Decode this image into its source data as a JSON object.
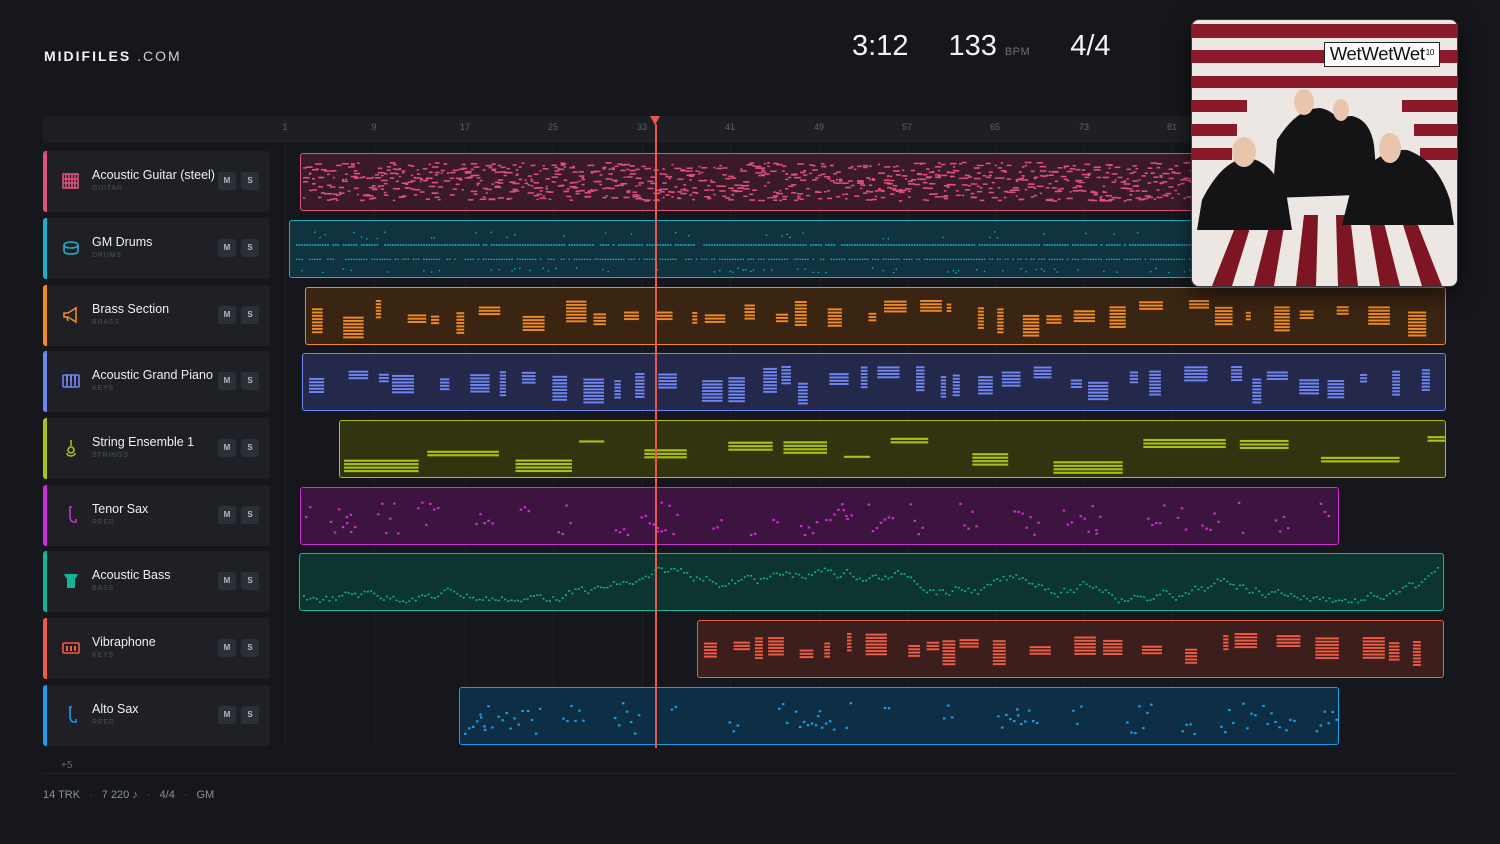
{
  "brand": {
    "name_bold": "MIDIFILES",
    "name_suffix": ".COM"
  },
  "transport": {
    "time": "3:12",
    "bpm": "133",
    "bpm_unit": "BPM",
    "time_signature": "4/4"
  },
  "ruler_ticks": [
    "1",
    "9",
    "17",
    "25",
    "33",
    "41",
    "49",
    "57",
    "65",
    "73",
    "81"
  ],
  "tracks": [
    {
      "name": "Acoustic Guitar (steel)",
      "category": "GUITAR",
      "icon": "guitar-icon",
      "color": "#e0507e",
      "mute": "M",
      "solo": "S"
    },
    {
      "name": "GM Drums",
      "category": "DRUMS",
      "icon": "drum-icon",
      "color": "#1eaec8",
      "mute": "M",
      "solo": "S"
    },
    {
      "name": "Brass Section",
      "category": "BRASS",
      "icon": "horn-icon",
      "color": "#f08a24",
      "mute": "M",
      "solo": "S"
    },
    {
      "name": "Acoustic Grand Piano",
      "category": "KEYS",
      "icon": "piano-icon",
      "color": "#6f86f2",
      "mute": "M",
      "solo": "S"
    },
    {
      "name": "String Ensemble 1",
      "category": "STRINGS",
      "icon": "violin-icon",
      "color": "#a8c219",
      "mute": "M",
      "solo": "S"
    },
    {
      "name": "Tenor Sax",
      "category": "REED",
      "icon": "sax-icon",
      "color": "#d12ad8",
      "mute": "M",
      "solo": "S"
    },
    {
      "name": "Acoustic Bass",
      "category": "BASS",
      "icon": "bass-icon",
      "color": "#13b59a",
      "mute": "M",
      "solo": "S"
    },
    {
      "name": "Vibraphone",
      "category": "KEYS",
      "icon": "vibraphone-icon",
      "color": "#f05b45",
      "mute": "M",
      "solo": "S"
    },
    {
      "name": "Alto Sax",
      "category": "REED",
      "icon": "sax-icon",
      "color": "#1b9de8",
      "mute": "M",
      "solo": "S"
    }
  ],
  "more_tracks": "+5",
  "footer": {
    "tracks": "14 TRK",
    "notes": "7 220 ♪",
    "time_signature": "4/4",
    "standard": "GM",
    "separator": "·"
  },
  "album": {
    "artist": "WetWetWet",
    "number": "10"
  }
}
